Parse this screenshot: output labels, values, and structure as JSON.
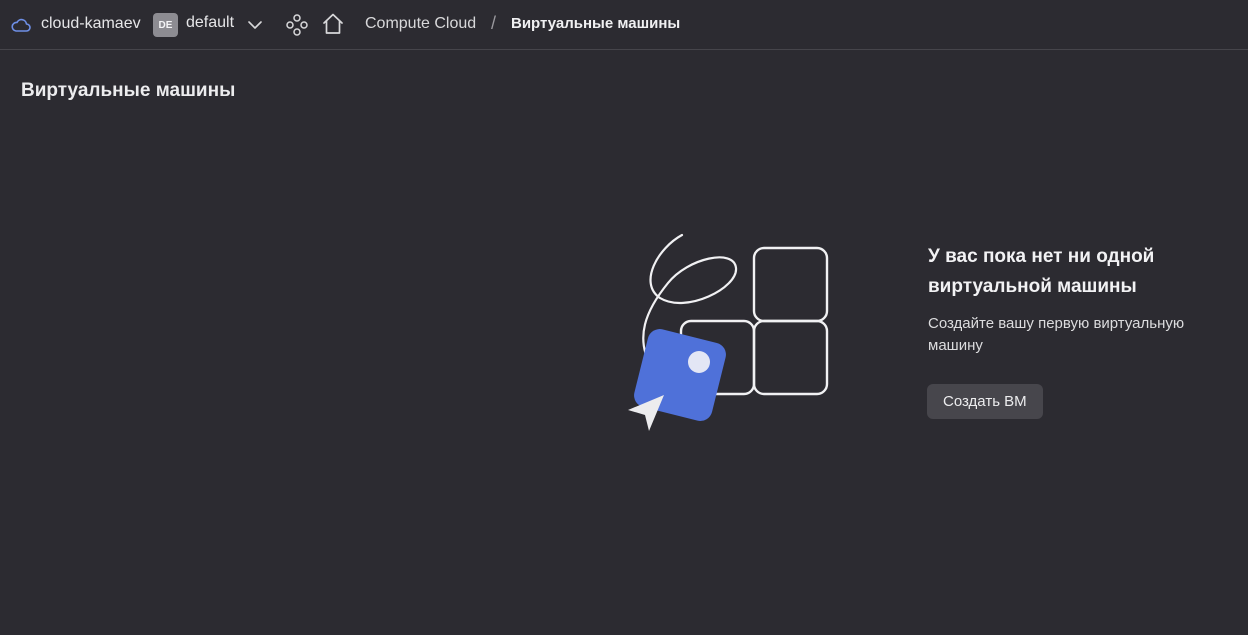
{
  "header": {
    "cloud_name": "cloud-kamaev",
    "folder_badge": "DE",
    "folder_name": "default",
    "icons": {
      "cloud": "cloud-icon",
      "folder_dropdown": "chevron-down-icon",
      "services": "services-icon",
      "home": "home-icon"
    },
    "breadcrumbs": [
      {
        "label": "Compute Cloud"
      },
      {
        "label": "Виртуальные машины"
      }
    ],
    "separator": "/"
  },
  "page": {
    "title": "Виртуальные машины"
  },
  "empty_state": {
    "illustration": "empty-vm-illustration",
    "title": "У вас пока нет ни одной виртуальной машины",
    "description": "Создайте вашу первую виртуальную машину",
    "button_label": "Создать ВМ"
  },
  "colors": {
    "background": "#2c2b31",
    "accent_blue": "#4f71d9",
    "button_bg": "#47464c"
  }
}
